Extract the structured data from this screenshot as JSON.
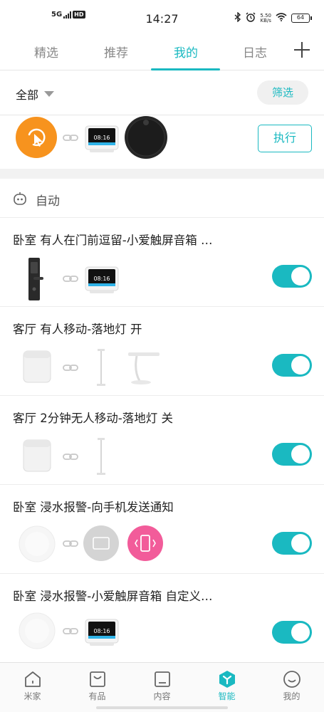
{
  "status_bar": {
    "network": "5G",
    "hd": "HD",
    "time": "14:27",
    "speed_value": "5.50",
    "speed_unit": "KB/s",
    "battery": "64"
  },
  "tabs": [
    {
      "label": "精选",
      "active": false
    },
    {
      "label": "推荐",
      "active": false
    },
    {
      "label": "我的",
      "active": true
    },
    {
      "label": "日志",
      "active": false
    }
  ],
  "filter": {
    "scope_label": "全部",
    "filter_button": "筛选"
  },
  "manual_scene": {
    "execute_button": "执行",
    "devices": [
      "manual-trigger-icon",
      "touchscreen-speaker",
      "robot-vacuum"
    ]
  },
  "auto_section": {
    "label": "自动"
  },
  "automations": [
    {
      "title": "卧室 有人在门前逗留-小爱触屏音箱 …",
      "enabled": true
    },
    {
      "title": "客厅 有人移动-落地灯 开",
      "enabled": true
    },
    {
      "title": "客厅 2分钟无人移动-落地灯 关",
      "enabled": true
    },
    {
      "title": "卧室 浸水报警-向手机发送通知",
      "enabled": true
    },
    {
      "title": "卧室 浸水报警-小爱触屏音箱 自定义…",
      "enabled": true
    }
  ],
  "screen_time": "08:16",
  "nav": [
    {
      "label": "米家",
      "icon": "home-icon",
      "active": false
    },
    {
      "label": "有品",
      "icon": "shopping-bag-icon",
      "active": false
    },
    {
      "label": "内容",
      "icon": "content-icon",
      "active": false
    },
    {
      "label": "智能",
      "icon": "smart-icon",
      "active": true
    },
    {
      "label": "我的",
      "icon": "profile-icon",
      "active": false
    }
  ],
  "colors": {
    "accent": "#1ab9c1",
    "manual_orange": "#f7931e",
    "notify_pink": "#f25c9a"
  }
}
